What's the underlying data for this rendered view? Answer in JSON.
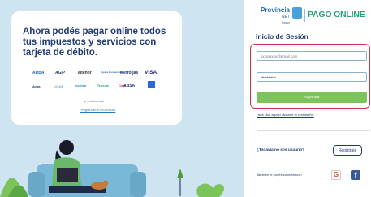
{
  "promo": {
    "title": "Ahora podés pagar online todos tus impuestos y servicios con tarjeta de débito.",
    "logos": [
      "ARBA",
      "AGIP",
      "edenor",
      "Aguas Bonaerenses",
      "Metrogas",
      "VISA",
      "Aysa",
      "OSDE",
      "movistar",
      "Telecom",
      "Claro",
      "ABSA",
      "Amex"
    ],
    "more_text": "y mucho más",
    "faq_label": "Preguntas Frecuentes"
  },
  "brand": {
    "provincia": "Provincia",
    "net": "NET",
    "pagos": "Pagos",
    "pago_online": "PAGO ONLINE"
  },
  "login": {
    "title": "Inicio de Sesión",
    "email_placeholder": "xxxxxxxxx@gmail.com",
    "password_value": "••••••••••••",
    "submit_label": "Ingresar",
    "forgot_label": "Hacé click aquí si olvidaste tu contraseña."
  },
  "register": {
    "question": "¿Todavía no sos usuario?",
    "button_label": "Registrate"
  },
  "social": {
    "text": "También te podés conectar con",
    "google_label": "G",
    "facebook_label": "f"
  },
  "colors": {
    "brand_blue": "#1f3a73",
    "accent_green": "#7cc35a",
    "highlight_red": "#d3354a",
    "background_blue": "#cfe4f1"
  }
}
